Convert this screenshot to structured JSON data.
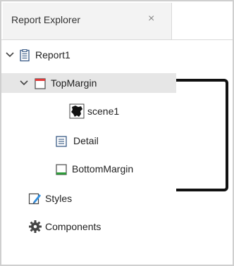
{
  "panel": {
    "tab_label": "Report Explorer",
    "tab_close_glyph": "×"
  },
  "tree": {
    "report": {
      "label": "Report1",
      "icon": "report-document-icon"
    },
    "top_margin": {
      "label": "TopMargin",
      "icon": "top-margin-band-icon",
      "accent": "#e03a3a"
    },
    "scene": {
      "label": "scene1",
      "icon": "map-shape-icon"
    },
    "detail": {
      "label": "Detail",
      "icon": "detail-band-icon"
    },
    "bottom_margin": {
      "label": "BottomMargin",
      "icon": "bottom-margin-band-icon",
      "accent": "#2e9b3a"
    },
    "styles": {
      "label": "Styles",
      "icon": "styles-brush-icon"
    },
    "components": {
      "label": "Components",
      "icon": "gear-icon"
    }
  },
  "colors": {
    "selected_row": "#e6e6e6",
    "annotation_bracket": "#111111"
  }
}
